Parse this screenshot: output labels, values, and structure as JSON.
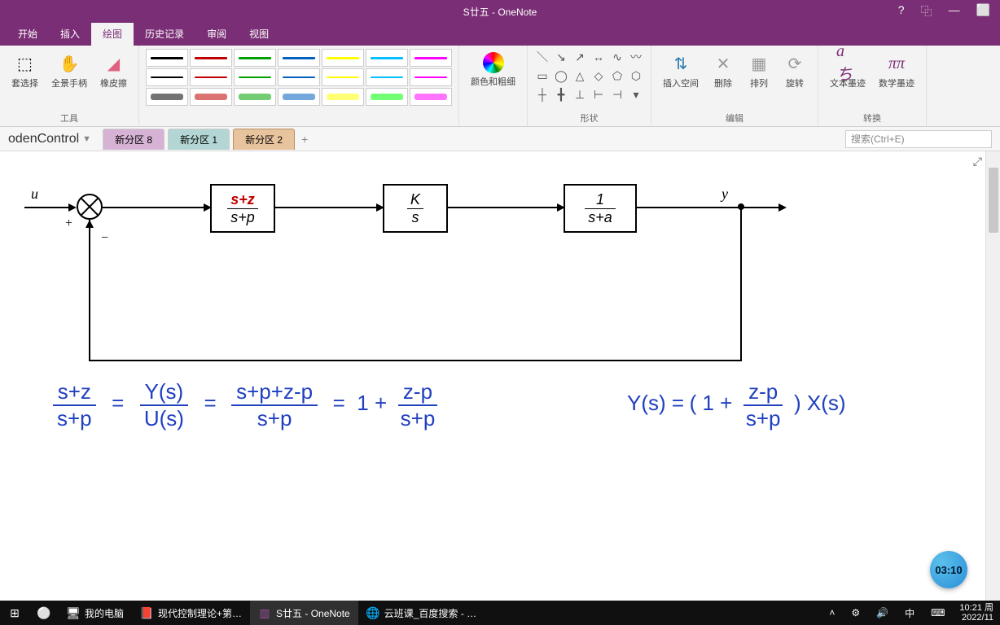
{
  "titlebar": {
    "title": "S廿五 - OneNote",
    "help": "?",
    "restore": "⿻",
    "minimize": "—",
    "maxlike": "⬜"
  },
  "menu": {
    "tabs": [
      "开始",
      "插入",
      "绘图",
      "历史记录",
      "审阅",
      "视图"
    ],
    "active_index": 2
  },
  "ribbon": {
    "tools": {
      "lasso": "套选择",
      "pan": "全景手柄",
      "eraser": "橡皮擦",
      "group_label": "工具"
    },
    "color_width": {
      "label": "颜色和粗细"
    },
    "shapes": {
      "group_label": "形状"
    },
    "edit": {
      "insert_space": "插入空间",
      "delete": "删除",
      "arrange": "排列",
      "rotate": "旋转",
      "group_label": "编辑"
    },
    "convert": {
      "ink_text": "文本墨迹",
      "ink_math": "数学墨迹",
      "group_label": "转换"
    }
  },
  "notebook": {
    "name": "odenControl",
    "sections": [
      {
        "label": "新分区 8",
        "color": "purple"
      },
      {
        "label": "新分区 1",
        "color": "teal"
      },
      {
        "label": "新分区 2",
        "color": "orange"
      }
    ],
    "add": "+",
    "search_placeholder": "搜索(Ctrl+E)"
  },
  "diagram": {
    "input": "u",
    "output": "y",
    "plus": "+",
    "minus": "−",
    "block1": {
      "num": "s+z",
      "den": "s+p"
    },
    "block2": {
      "num": "K",
      "den": "s"
    },
    "block3": {
      "num": "1",
      "den": "s+a"
    }
  },
  "handwriting": {
    "eq1_l_num": "s+z",
    "eq1_l_den": "s+p",
    "eq1_m_num": "Y(s)",
    "eq1_m_den": "U(s)",
    "eq1_r1_num": "s+p+z-p",
    "eq1_r1_den": "s+p",
    "eq1_r2_pre": "1 +",
    "eq1_r2_num": "z-p",
    "eq1_r2_den": "s+p",
    "eq2_lhs": "Y(s) =",
    "eq2_paren_open": "( 1 +",
    "eq2_num": "z-p",
    "eq2_den": "s+p",
    "eq2_paren_close": ") X(s)",
    "equals": "="
  },
  "timer": "03:10",
  "taskbar": {
    "start": "⊞",
    "search": "⚪",
    "mycomputer": "我的电脑",
    "pdf": "现代控制理论+第…",
    "onenote": "S廿五 - OneNote",
    "chrome": "云班课_百度搜索 - …",
    "tray_up": "˄",
    "clock_time": "10:21 周",
    "clock_date": "2022/11"
  },
  "pen_colors": [
    [
      "#000000",
      "#c00000",
      "#00a000",
      "#0060c0",
      "#ffff00",
      "#00c0ff",
      "#ff00ff"
    ],
    [
      "#000000",
      "#c00000",
      "#00a000",
      "#0060c0",
      "#ffff00",
      "#00c0ff",
      "#ff00ff"
    ],
    [
      "#000000",
      "#c00000",
      "#00a000",
      "#0060c0",
      "#ffff00",
      "#00ff00",
      "#ff00ff"
    ]
  ]
}
